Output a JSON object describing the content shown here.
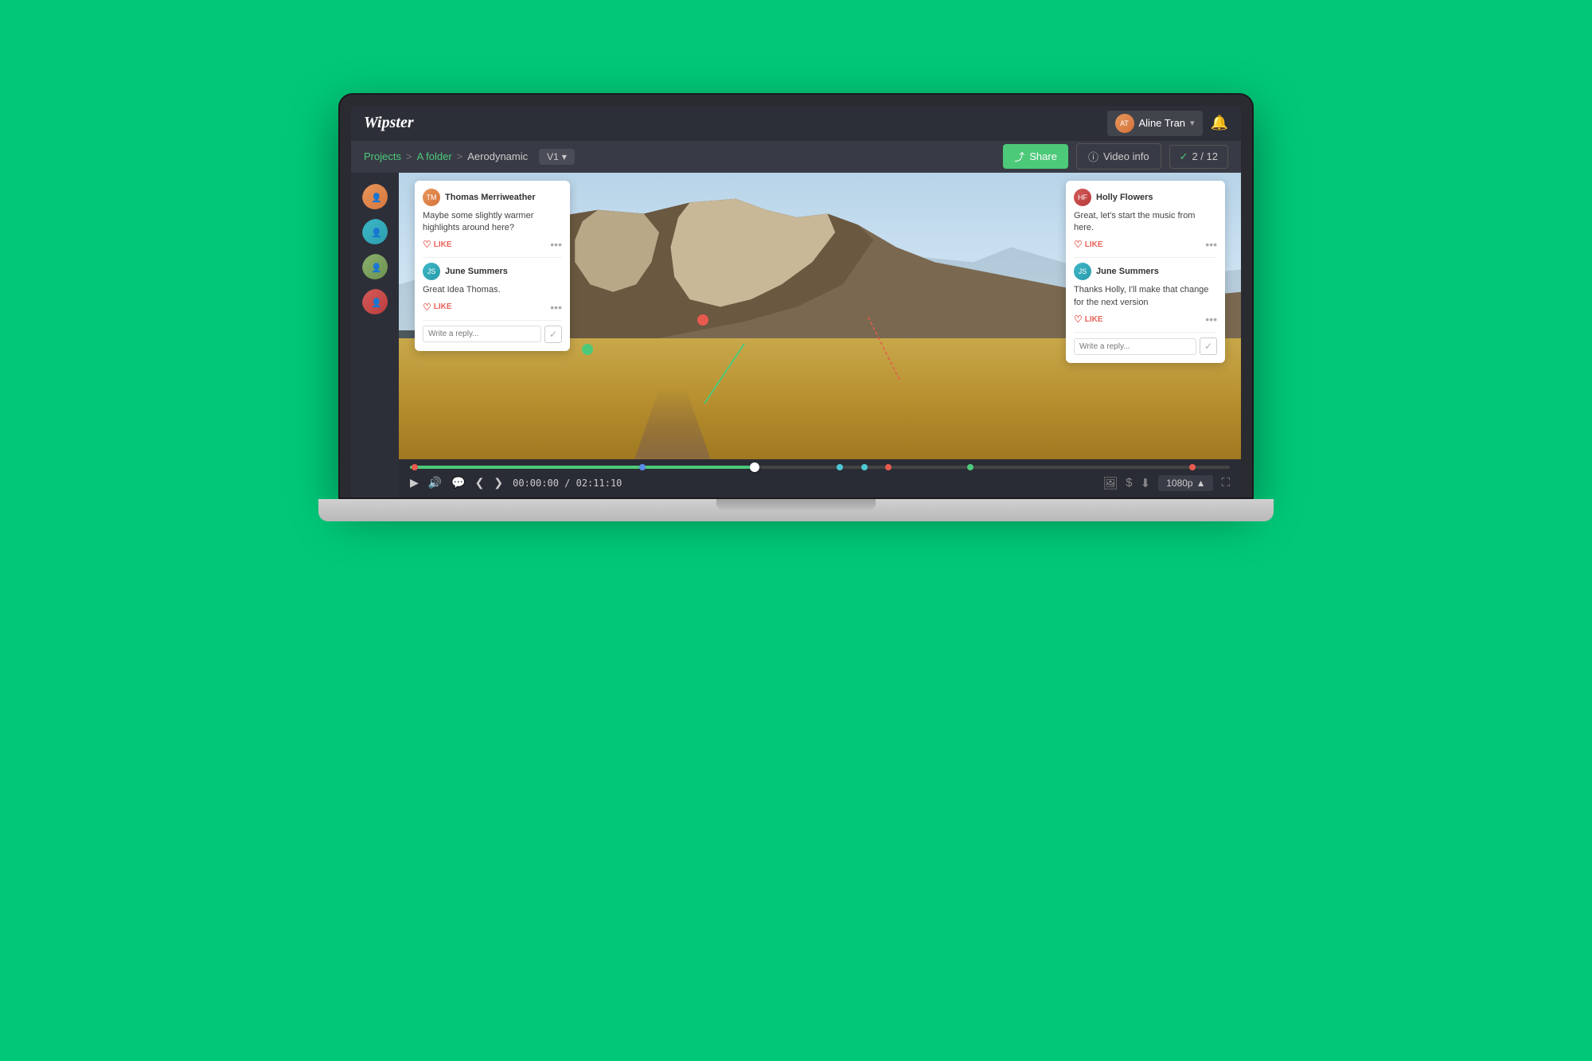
{
  "app": {
    "name": "Wipster"
  },
  "nav": {
    "user_name": "Aline Tran",
    "bell_label": "notifications"
  },
  "breadcrumb": {
    "projects": "Projects",
    "sep1": ">",
    "folder": "A folder",
    "sep2": ">",
    "project": "Aerodynamic",
    "version": "V1"
  },
  "toolbar": {
    "share_label": "Share",
    "video_info_label": "Video info",
    "count_label": "2 / 12"
  },
  "comment_left": {
    "author1": "Thomas Merriweather",
    "time1": "",
    "text1": "Maybe some slightly warmer highlights around here?",
    "like1": "LIKE",
    "author2": "June Summers",
    "time2": "",
    "text2": "Great Idea Thomas.",
    "like2": "LIKE",
    "reply_placeholder": "Write a reply..."
  },
  "comment_right": {
    "author1": "Holly Flowers",
    "time1": "",
    "text1": "Great, let's start the music from here.",
    "like1": "LIKE",
    "author2": "June Summers",
    "time2": "",
    "text2": "Thanks Holly, I'll make that change for the next version",
    "like2": "LIKE",
    "reply_placeholder": "Write a reply..."
  },
  "video_controls": {
    "time_current": "00:00:00",
    "time_total": "02:11:10",
    "quality": "1080p"
  },
  "avatars": [
    {
      "label": "User 1",
      "color": "av-orange"
    },
    {
      "label": "User 2",
      "color": "av-teal"
    },
    {
      "label": "User 3",
      "color": "av-olive"
    },
    {
      "label": "User 4",
      "color": "av-red"
    }
  ]
}
